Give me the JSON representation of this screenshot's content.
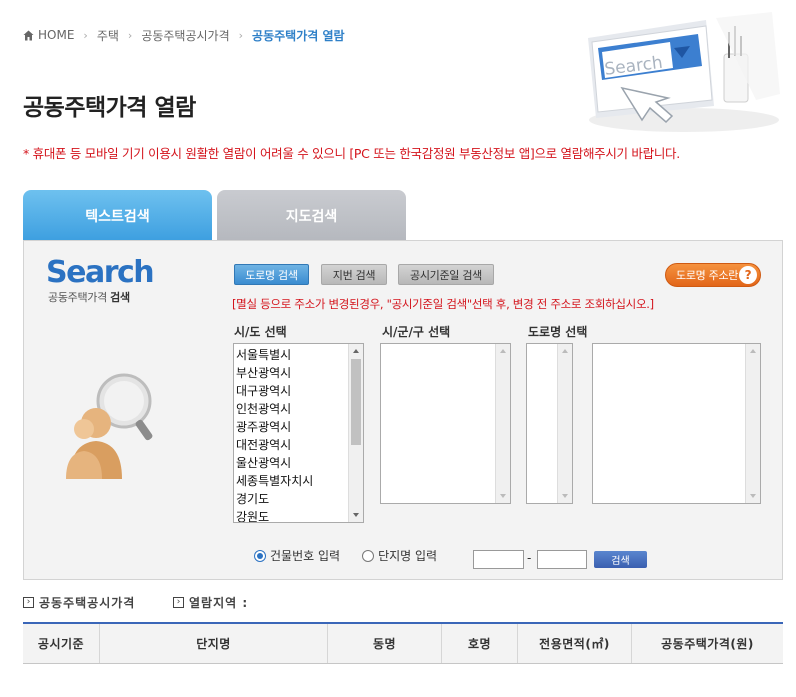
{
  "breadcrumb": {
    "items": [
      "HOME",
      "주택",
      "공동주택공시가격",
      "공동주택가격 열람"
    ]
  },
  "hero": {
    "search_text": "Search"
  },
  "page_title": "공동주택가격 열람",
  "notice": "* 휴대폰 등 모바일 기기 이용시 원활한 열람이 어려울 수 있으니 [PC 또는 한국감정원 부동산정보 앱]으로 열람해주시기 바랍니다.",
  "tabs": [
    {
      "label": "텍스트검색",
      "active": true
    },
    {
      "label": "지도검색",
      "active": false
    }
  ],
  "panel": {
    "logo": "Search",
    "subtitle_prefix": "공동주택가격",
    "subtitle_bold": "검색",
    "buttons": {
      "road": "도로명 검색",
      "lot": "지번 검색",
      "date": "공시기준일 검색",
      "help": "도로명 주소란",
      "help_mark": "?"
    },
    "warning": "[멸실 등으로 주소가 변경된경우, \"공시기준일 검색\"선택 후, 변경 전 주소로 조회하십시오.]",
    "columns": {
      "sido": "시/도 선택",
      "sigungu": "시/군/구 선택",
      "road": "도로명 선택"
    },
    "sido_items": [
      "서울특별시",
      "부산광역시",
      "대구광역시",
      "인천광역시",
      "광주광역시",
      "대전광역시",
      "울산광역시",
      "세종특별자치시",
      "경기도",
      "강원도"
    ],
    "radio_building": "건물번호 입력",
    "radio_complex": "단지명 입력",
    "range_dash": "-",
    "search_button": "검색"
  },
  "results": {
    "label1": "공동주택공시가격",
    "label2": "열람지역 :",
    "columns": [
      "공시기준",
      "단지명",
      "동명",
      "호명",
      "전용면적(㎡)",
      "공동주택가격(원)"
    ]
  },
  "colors": {
    "accent": "#2f80c8",
    "notice_red": "#d4141c",
    "help_orange": "#e2661a",
    "tab_active": "#3d9fe0",
    "table_border": "#3a66b8"
  }
}
